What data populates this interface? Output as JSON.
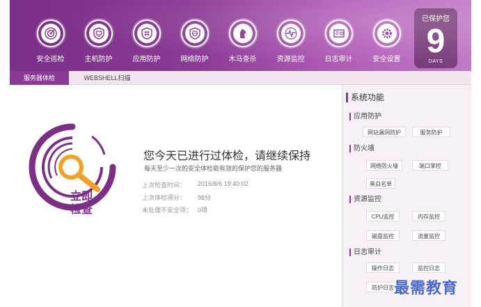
{
  "topbar": {
    "nav": [
      {
        "label": "安全巡检",
        "icon": "radar-icon"
      },
      {
        "label": "主机防护",
        "icon": "host-shield-icon"
      },
      {
        "label": "应用防护",
        "icon": "app-shield-icon"
      },
      {
        "label": "网络防护",
        "icon": "network-shield-icon"
      },
      {
        "label": "木马查杀",
        "icon": "trojan-horse-icon"
      },
      {
        "label": "资源监控",
        "icon": "pulse-monitor-icon"
      },
      {
        "label": "日志审计",
        "icon": "log-audit-icon"
      },
      {
        "label": "安全设置",
        "icon": "gear-icon"
      }
    ],
    "protect": {
      "label": "已保护您",
      "days": "9",
      "unit": "DAYS"
    }
  },
  "tabs": {
    "server_check": "服务器体检",
    "webshell": "WEBSHELL扫描"
  },
  "main": {
    "logo_line1": "立即",
    "logo_line2": "检查",
    "title": "您今天已进行过体检，请继续保持",
    "subtitle": "每天至少一次的安全体检能有效的保护您的服务器",
    "info": [
      {
        "key": "上次检查时间：",
        "value": "2016/8/6  19:40:02"
      },
      {
        "key": "上次体检得分：",
        "value": "98分"
      },
      {
        "key": "未处理不安全项：",
        "value": "0项"
      }
    ]
  },
  "side": {
    "title": "系统功能",
    "sections": [
      {
        "name": "应用防护",
        "items": [
          "网站漏洞防护",
          "服务防护"
        ]
      },
      {
        "name": "防火墙",
        "items": [
          "网络防火墙",
          "端口掌控",
          "黑白名单"
        ]
      },
      {
        "name": "资源监控",
        "items": [
          "CPU监控",
          "内存监控",
          "磁盘监控",
          "流量监控"
        ]
      },
      {
        "name": "日志审计",
        "items": [
          "操作日志",
          "监控日志",
          "防护日志"
        ]
      }
    ]
  },
  "watermark": "最需教育",
  "colors": {
    "brand_purple": "#8a3a95",
    "accent_orange": "#f0a22a"
  }
}
